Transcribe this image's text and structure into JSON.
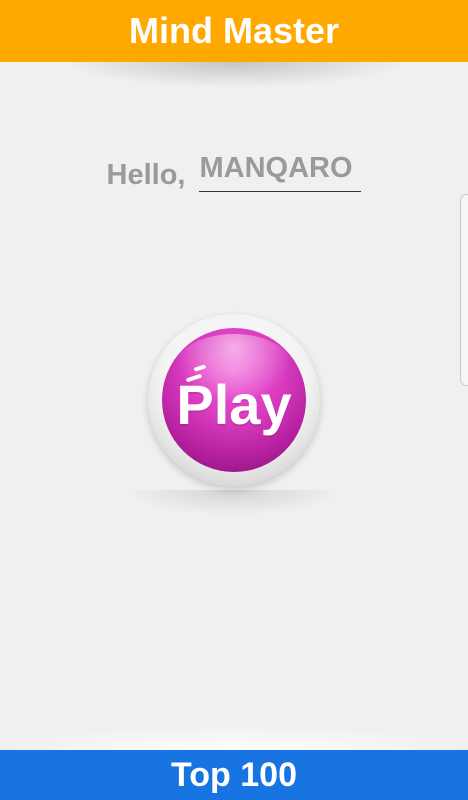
{
  "header": {
    "title": "Mind Master"
  },
  "greeting": {
    "label": "Hello,",
    "name": "MANQARO"
  },
  "play": {
    "label": "Play"
  },
  "footer": {
    "label": "Top 100"
  },
  "colors": {
    "header_bg": "#ffa800",
    "footer_bg": "#1774e0",
    "play_button": "#d93bbf",
    "background": "#f0f0f0",
    "greeting_text": "#9a9a9a"
  }
}
